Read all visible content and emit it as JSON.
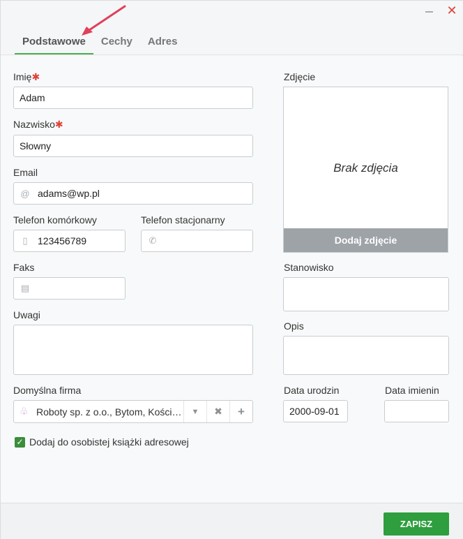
{
  "window": {
    "minimize": "–",
    "close": "✕"
  },
  "tabs": [
    {
      "label": "Podstawowe",
      "active": true
    },
    {
      "label": "Cechy"
    },
    {
      "label": "Adres"
    }
  ],
  "form": {
    "first_name": {
      "label": "Imię",
      "value": "Adam"
    },
    "last_name": {
      "label": "Nazwisko",
      "value": "Słowny"
    },
    "required_marker": "✱",
    "email": {
      "label": "Email",
      "value": "adams@wp.pl",
      "icon": "at-icon"
    },
    "mobile": {
      "label": "Telefon komórkowy",
      "value": "123456789",
      "icon": "mobile-phone-icon"
    },
    "landline": {
      "label": "Telefon stacjonarny",
      "value": "",
      "icon": "phone-icon"
    },
    "fax": {
      "label": "Faks",
      "value": "",
      "icon": "fax-icon"
    },
    "notes": {
      "label": "Uwagi",
      "value": ""
    },
    "default_company": {
      "label": "Domyślna firma",
      "value": "Roboty sp. z o.o., Bytom, Kości…",
      "icon": "company-icon"
    },
    "add_to_book": {
      "label": "Dodaj do osobistej książki adresowej",
      "checked": true
    }
  },
  "photo": {
    "label": "Zdjęcie",
    "placeholder": "Brak zdjęcia",
    "add_label": "Dodaj zdjęcie"
  },
  "position": {
    "label": "Stanowisko",
    "value": ""
  },
  "description": {
    "label": "Opis",
    "value": ""
  },
  "birthday": {
    "label": "Data urodzin",
    "value": "2000-09-01"
  },
  "name_day": {
    "label": "Data imienin",
    "value": ""
  },
  "footer": {
    "save_label": "ZAPISZ"
  },
  "colors": {
    "accent": "#2e9e3e",
    "required": "#e0403a",
    "arrow": "#e0405a"
  }
}
